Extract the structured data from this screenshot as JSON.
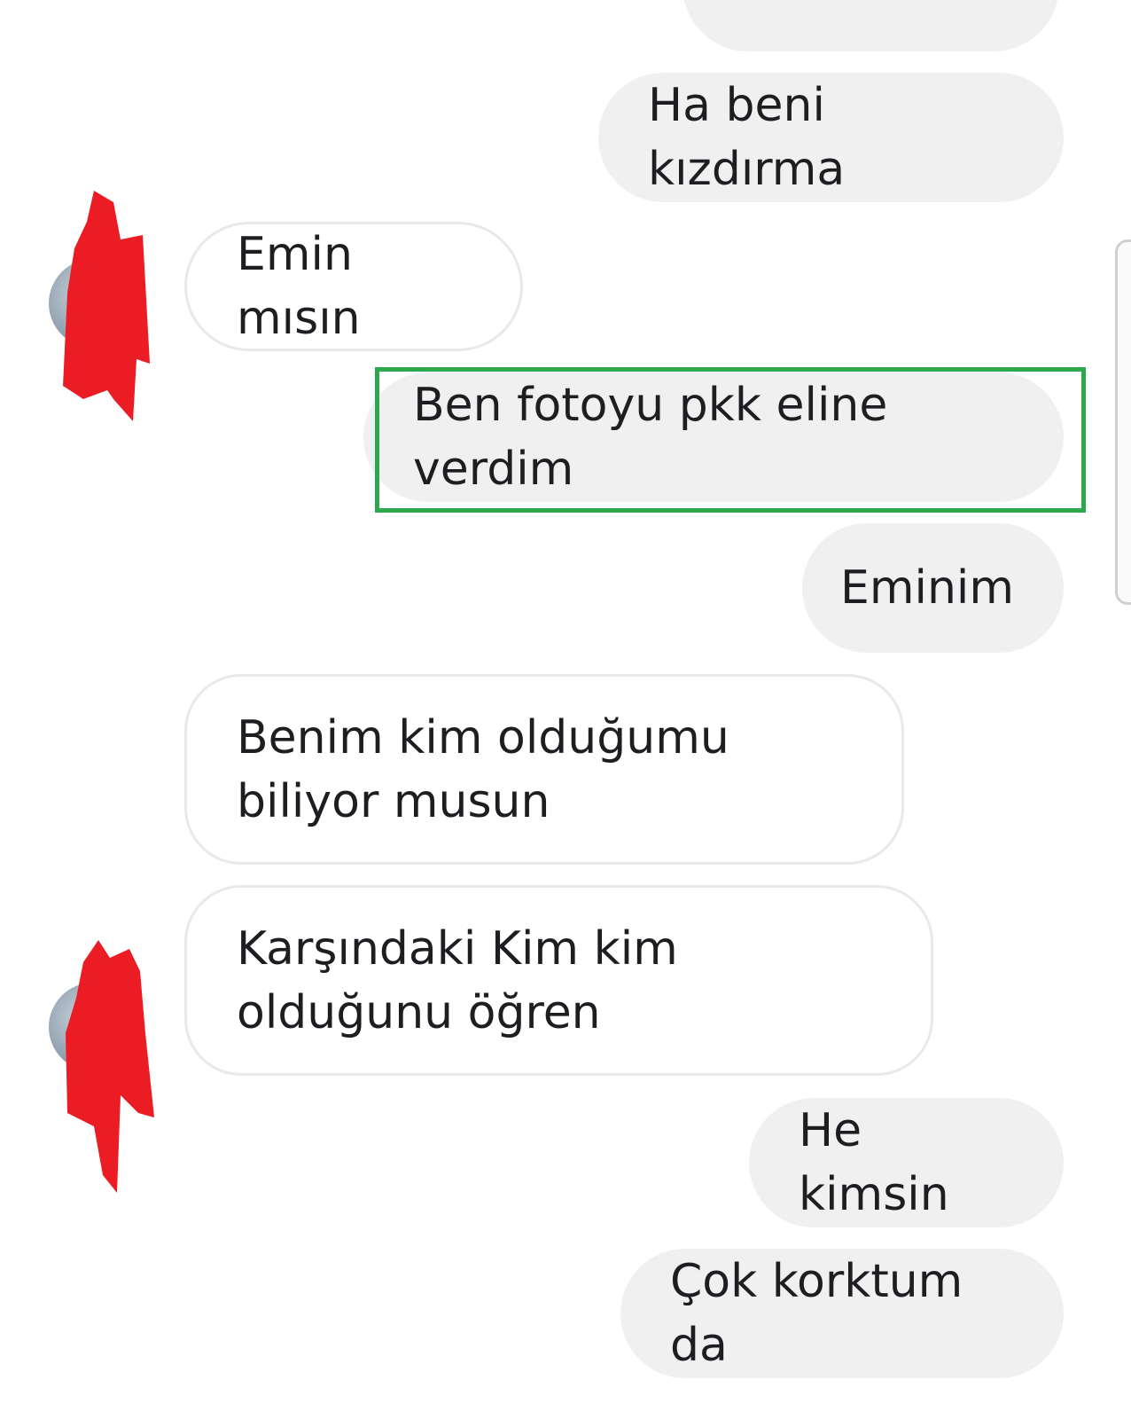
{
  "conversation": {
    "messages": [
      {
        "id": "m1",
        "direction": "sent",
        "text": "Ha beni kızdırma"
      },
      {
        "id": "m2",
        "direction": "received",
        "text": "Emin mısın"
      },
      {
        "id": "m3",
        "direction": "sent",
        "text": "Ben fotoyu pkk eline verdim",
        "highlighted": true
      },
      {
        "id": "m4",
        "direction": "sent",
        "text": "Eminim"
      },
      {
        "id": "m5",
        "direction": "received",
        "text": "Benim kim olduğumu biliyor musun"
      },
      {
        "id": "m6",
        "direction": "received",
        "text": "Karşındaki Kim kim olduğunu öğren"
      },
      {
        "id": "m7",
        "direction": "sent",
        "text": "He kimsin"
      },
      {
        "id": "m8",
        "direction": "sent",
        "text": "Çok korktum da"
      }
    ]
  },
  "colors": {
    "sent_bubble": "#f0f0f0",
    "received_border": "#e9e9e9",
    "highlight": "#2ea84d",
    "redaction": "#ec1c24",
    "text": "#1c1e21"
  },
  "icons": {
    "avatar": "contact-avatar",
    "redaction": "red-scribble"
  }
}
